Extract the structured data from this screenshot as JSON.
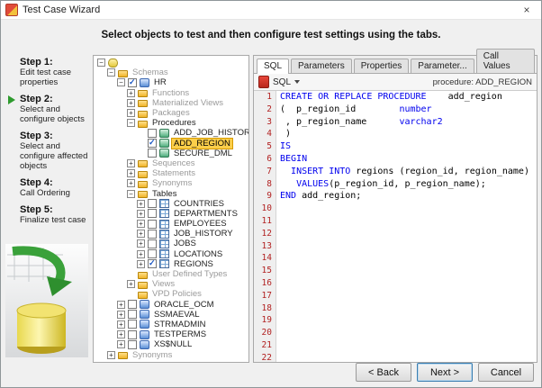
{
  "window": {
    "title": "Test Case Wizard",
    "close_glyph": "×"
  },
  "header": {
    "text": "Select objects to test and then configure test settings using the tabs."
  },
  "steps": {
    "items": [
      {
        "label": "Step 1:",
        "desc": "Edit test case properties",
        "current": false
      },
      {
        "label": "Step 2:",
        "desc": "Select and configure objects",
        "current": true
      },
      {
        "label": "Step 3:",
        "desc": "Select and configure affected objects",
        "current": false
      },
      {
        "label": "Step 4:",
        "desc": "Call Ordering",
        "current": false
      },
      {
        "label": "Step 5:",
        "desc": "Finalize test case",
        "current": false
      }
    ]
  },
  "tree": {
    "items": [
      {
        "depth": 0,
        "label": "",
        "expander": "minus",
        "icon": "db"
      },
      {
        "depth": 1,
        "label": "Schemas",
        "expander": "minus",
        "icon": "folder",
        "dim": true
      },
      {
        "depth": 2,
        "label": "HR",
        "expander": "minus",
        "checkbox": "checked",
        "icon": "schema"
      },
      {
        "depth": 3,
        "label": "Functions",
        "expander": "plus",
        "icon": "folder",
        "dim": true
      },
      {
        "depth": 3,
        "label": "Materialized Views",
        "expander": "plus",
        "icon": "folder",
        "dim": true
      },
      {
        "depth": 3,
        "label": "Packages",
        "expander": "plus",
        "icon": "folder",
        "dim": true
      },
      {
        "depth": 3,
        "label": "Procedures",
        "expander": "minus",
        "icon": "folder",
        "dim": false
      },
      {
        "depth": 4,
        "label": "ADD_JOB_HISTORY",
        "checkbox": "unchecked",
        "icon": "proc"
      },
      {
        "depth": 4,
        "label": "ADD_REGION",
        "checkbox": "checked",
        "icon": "proc",
        "selected": true
      },
      {
        "depth": 4,
        "label": "SECURE_DML",
        "checkbox": "unchecked",
        "icon": "proc"
      },
      {
        "depth": 3,
        "label": "Sequences",
        "expander": "plus",
        "icon": "folder",
        "dim": true
      },
      {
        "depth": 3,
        "label": "Statements",
        "expander": "plus",
        "icon": "folder",
        "dim": true
      },
      {
        "depth": 3,
        "label": "Synonyms",
        "expander": "plus",
        "icon": "folder",
        "dim": true
      },
      {
        "depth": 3,
        "label": "Tables",
        "expander": "minus",
        "icon": "folder",
        "dim": false
      },
      {
        "depth": 4,
        "label": "COUNTRIES",
        "expander": "plus",
        "checkbox": "unchecked",
        "icon": "table"
      },
      {
        "depth": 4,
        "label": "DEPARTMENTS",
        "expander": "plus",
        "checkbox": "unchecked",
        "icon": "table"
      },
      {
        "depth": 4,
        "label": "EMPLOYEES",
        "expander": "plus",
        "checkbox": "unchecked",
        "icon": "table"
      },
      {
        "depth": 4,
        "label": "JOB_HISTORY",
        "expander": "plus",
        "checkbox": "unchecked",
        "icon": "table"
      },
      {
        "depth": 4,
        "label": "JOBS",
        "expander": "plus",
        "checkbox": "unchecked",
        "icon": "table"
      },
      {
        "depth": 4,
        "label": "LOCATIONS",
        "expander": "plus",
        "checkbox": "unchecked",
        "icon": "table"
      },
      {
        "depth": 4,
        "label": "REGIONS",
        "expander": "plus",
        "checkbox": "checked",
        "icon": "table"
      },
      {
        "depth": 3,
        "label": "User Defined Types",
        "icon": "folder",
        "dim": true
      },
      {
        "depth": 3,
        "label": "Views",
        "expander": "plus",
        "icon": "folder",
        "dim": true
      },
      {
        "depth": 3,
        "label": "VPD Policies",
        "icon": "folder",
        "dim": true
      },
      {
        "depth": 2,
        "label": "ORACLE_OCM",
        "expander": "plus",
        "checkbox": "unchecked",
        "icon": "schema"
      },
      {
        "depth": 2,
        "label": "SSMAEVAL",
        "expander": "plus",
        "checkbox": "unchecked",
        "icon": "schema"
      },
      {
        "depth": 2,
        "label": "STRMADMIN",
        "expander": "plus",
        "checkbox": "unchecked",
        "icon": "schema"
      },
      {
        "depth": 2,
        "label": "TESTPERMS",
        "expander": "plus",
        "checkbox": "unchecked",
        "icon": "schema"
      },
      {
        "depth": 2,
        "label": "XS$NULL",
        "expander": "plus",
        "checkbox": "unchecked",
        "icon": "schema"
      },
      {
        "depth": 1,
        "label": "Synonyms",
        "expander": "plus",
        "icon": "folder",
        "dim": true
      }
    ]
  },
  "editor": {
    "tabs": [
      "SQL",
      "Parameters",
      "Properties",
      "Parameter...",
      "Call Values"
    ],
    "active_index": 0,
    "toolbar": {
      "dropdown_label": "SQL",
      "context": "procedure: ADD_REGION"
    },
    "lines": [
      [
        {
          "t": "CREATE OR REPLACE PROCEDURE",
          "k": 1
        },
        {
          "t": "    add_region",
          "k": 0
        }
      ],
      [
        {
          "t": "(  p_region_id        ",
          "k": 0
        },
        {
          "t": "number",
          "k": 1
        }
      ],
      [
        {
          "t": " , p_region_name      ",
          "k": 0
        },
        {
          "t": "varchar2",
          "k": 1
        }
      ],
      [
        {
          "t": " )",
          "k": 0
        }
      ],
      [
        {
          "t": "IS",
          "k": 1
        }
      ],
      [
        {
          "t": "BEGIN",
          "k": 1
        }
      ],
      [
        {
          "t": "  ",
          "k": 0
        },
        {
          "t": "INSERT INTO",
          "k": 1
        },
        {
          "t": " regions (region_id, region_name)",
          "k": 0
        }
      ],
      [
        {
          "t": "   ",
          "k": 0
        },
        {
          "t": "VALUES",
          "k": 1
        },
        {
          "t": "(p_region_id, p_region_name);",
          "k": 0
        }
      ],
      [
        {
          "t": "END",
          "k": 1
        },
        {
          "t": " add_region;",
          "k": 0
        }
      ],
      [],
      [],
      [],
      [],
      [],
      [],
      [],
      [],
      [],
      [],
      [],
      [],
      []
    ]
  },
  "footer": {
    "buttons": [
      {
        "label": "< Back",
        "name": "back-button",
        "default": false
      },
      {
        "label": "Next >",
        "name": "next-button",
        "default": true
      },
      {
        "label": "Cancel",
        "name": "cancel-button",
        "default": false
      }
    ]
  },
  "colors": {
    "selection_highlight": "#fbce4a",
    "keyword_blue": "#0000ee",
    "line_number_red": "#b22222",
    "step_arrow_green": "#2e9b2e"
  }
}
